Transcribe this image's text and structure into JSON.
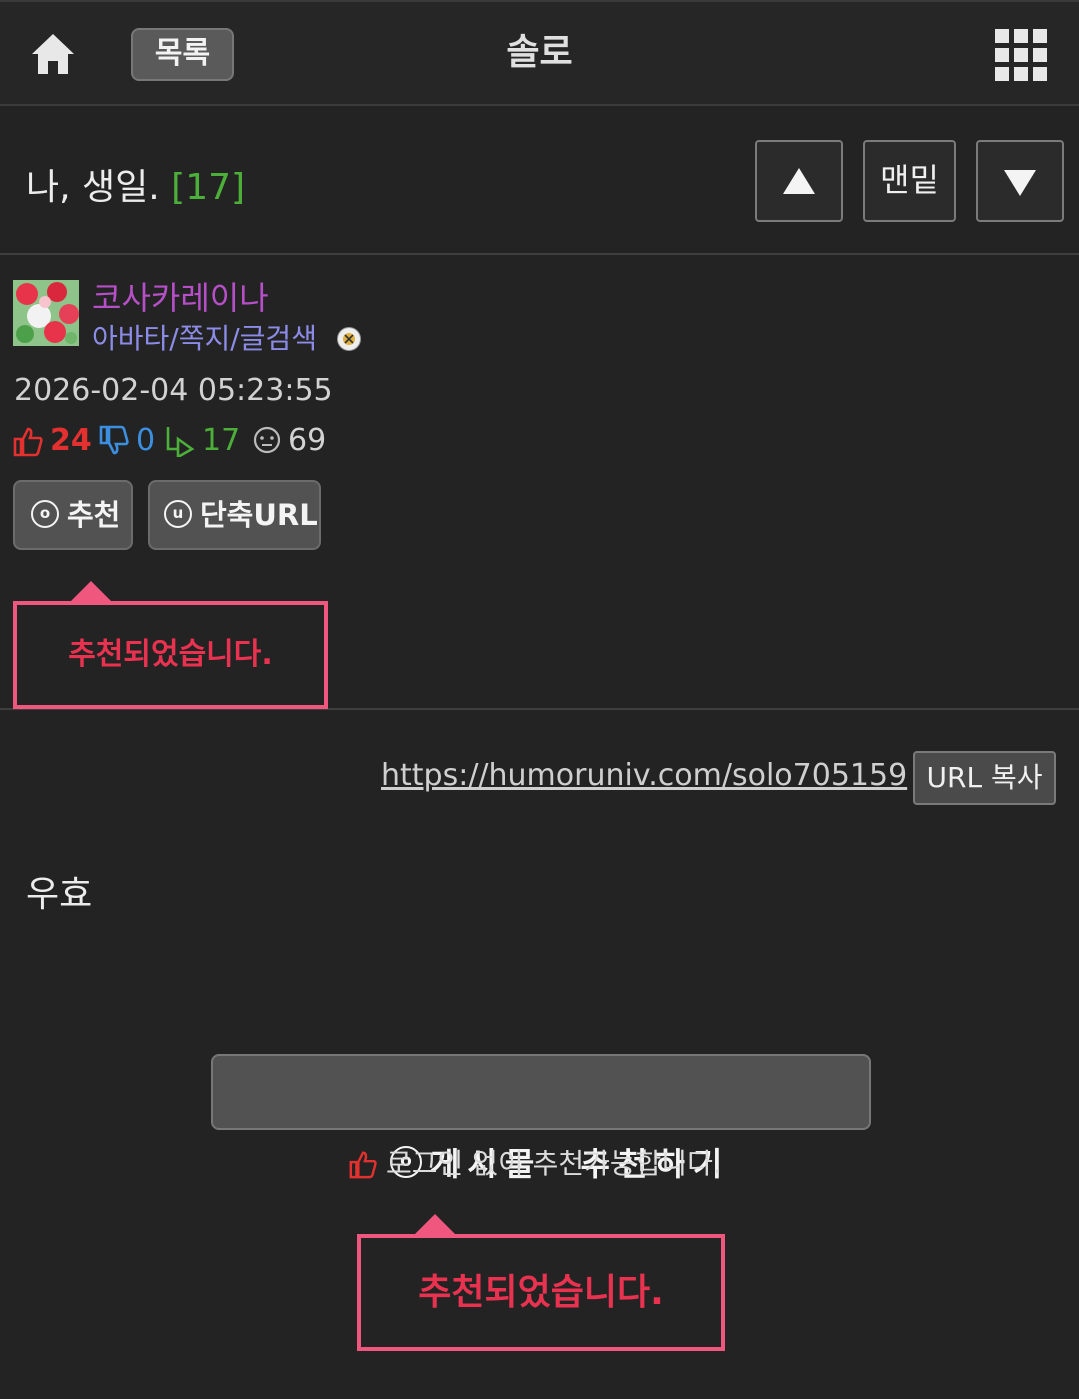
{
  "header": {
    "home_icon": "home-icon",
    "list_label": "목록",
    "board_title": "솔로",
    "menu_icon": "grid-icon"
  },
  "post": {
    "title": "나, 생일.",
    "comment_count": "[17]",
    "nav": {
      "up_icon": "triangle-up-icon",
      "bottom_label": "맨밑",
      "down_icon": "triangle-down-icon"
    },
    "author": {
      "nickname": "코사카레이나",
      "menu_link": "아바타/쪽지/글검색",
      "level_icon": "level-badge-icon"
    },
    "datetime": "2026-02-04 05:23:55",
    "stats": {
      "likes": "24",
      "dislikes": "0",
      "replies": "17",
      "views": "69"
    },
    "buttons": {
      "recommend_letter": "o",
      "recommend_label": "추천",
      "short_url_letter": "u",
      "short_url_label": "단축URL"
    },
    "toast_message": "추천되었습니다.",
    "url": "https://humoruniv.com/solo705159",
    "url_copy_label": "URL 복사",
    "content": "우효",
    "recommend_big_letter": "o",
    "recommend_big_label": "게시물  추천하기",
    "nologin_text": "로그인 없이 추천가능합니다.",
    "toast_message_bottom": "추천되었습니다."
  },
  "colors": {
    "background": "#232323",
    "nickname": "#b64fc8",
    "menu_link": "#8c8ce8",
    "like": "#e2312f",
    "dislike": "#3b8fe0",
    "reply": "#4caf3a",
    "toast_border": "#f0577e",
    "toast_text": "#e8324f"
  }
}
